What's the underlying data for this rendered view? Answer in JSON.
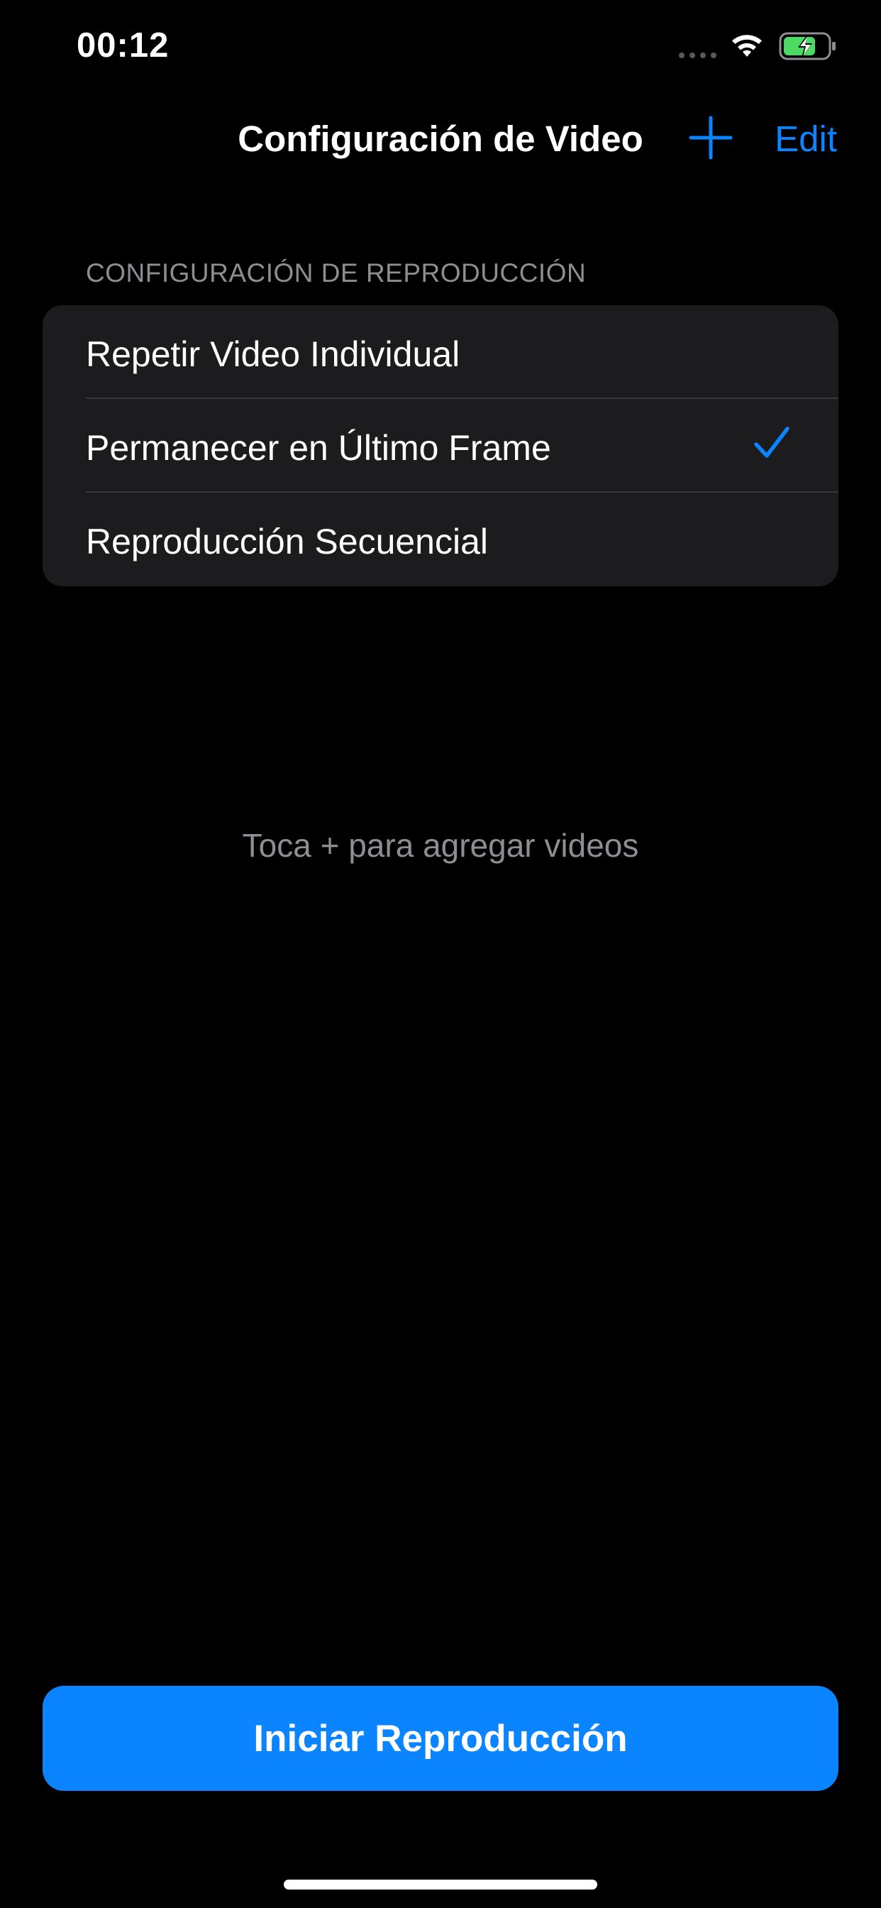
{
  "status_bar": {
    "time": "00:12",
    "signal_icon": "cellular-dots-icon",
    "wifi_icon": "wifi-icon",
    "battery_icon": "battery-charging-icon",
    "battery_color": "#4cd964"
  },
  "nav": {
    "title": "Configuración de Video",
    "add_icon": "plus-icon",
    "edit_label": "Edit"
  },
  "playback_settings": {
    "header": "CONFIGURACIÓN DE REPRODUCCIÓN",
    "options": [
      {
        "label": "Repetir Video Individual",
        "selected": false
      },
      {
        "label": "Permanecer en Último Frame",
        "selected": true
      },
      {
        "label": "Reproducción Secuencial",
        "selected": false
      }
    ]
  },
  "empty_state": {
    "message": "Toca + para agregar videos"
  },
  "actions": {
    "start_label": "Iniciar Reproducción"
  },
  "colors": {
    "accent": "#0a84ff",
    "background": "#000000",
    "group_background": "#1c1c1e",
    "secondary_text": "#8d8d93"
  }
}
